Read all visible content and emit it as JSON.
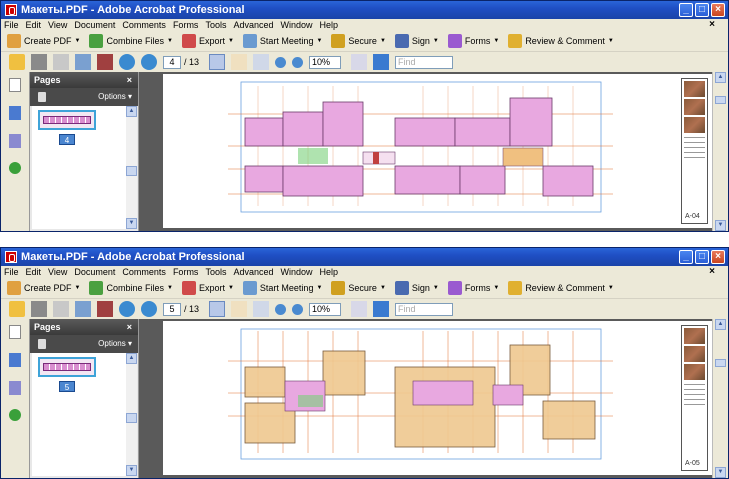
{
  "app": {
    "title": "Макеты.PDF - Adobe Acrobat Professional"
  },
  "menu": [
    "File",
    "Edit",
    "View",
    "Document",
    "Comments",
    "Forms",
    "Tools",
    "Advanced",
    "Window",
    "Help"
  ],
  "toolbar": {
    "create_pdf": "Create PDF",
    "combine_files": "Combine Files",
    "export": "Export",
    "start_meeting": "Start Meeting",
    "secure": "Secure",
    "sign": "Sign",
    "forms": "Forms",
    "review_comment": "Review & Comment"
  },
  "nav": {
    "total": "/ 13",
    "zoom": "10%",
    "find_placeholder": "Find"
  },
  "pages_panel": {
    "title": "Pages",
    "options": "Options"
  },
  "windows": [
    {
      "page": "4",
      "thumb_label": "4",
      "sheet": "A-04"
    },
    {
      "page": "5",
      "thumb_label": "5",
      "sheet": "A-05"
    }
  ],
  "colors": {
    "titlebar": "#1f4fc4",
    "room_pink": "#e8a8e0",
    "room_tan": "#efc890",
    "gridline": "#e07030"
  }
}
